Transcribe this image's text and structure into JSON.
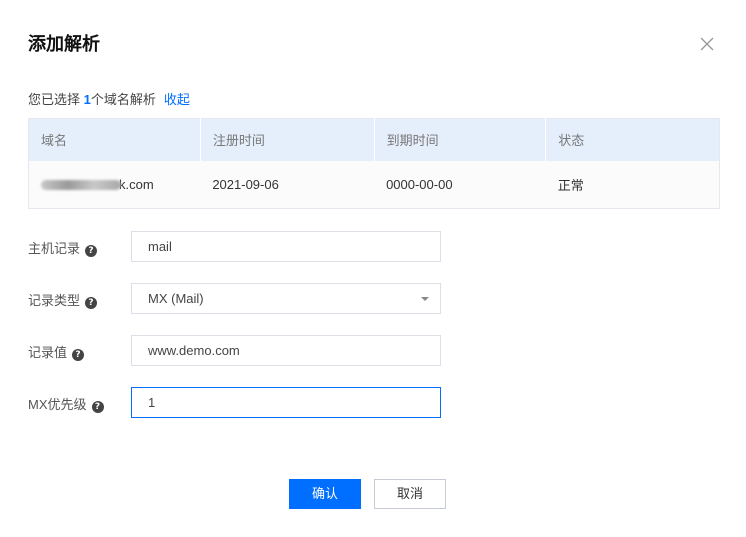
{
  "dialog": {
    "title": "添加解析",
    "close_icon": "close-icon"
  },
  "summary": {
    "prefix": "您已选择 ",
    "count": "1",
    "suffix": "个域名解析",
    "collapse_label": "收起"
  },
  "table": {
    "headers": [
      "域名",
      "注册时间",
      "到期时间",
      "状态"
    ],
    "rows": [
      {
        "domain_visible": "k.com",
        "registered": "2021-09-06",
        "expires": "0000-00-00",
        "status": "正常"
      }
    ]
  },
  "form": {
    "host_record": {
      "label": "主机记录",
      "value": "mail"
    },
    "record_type": {
      "label": "记录类型",
      "value": "MX (Mail)"
    },
    "record_value": {
      "label": "记录值",
      "value": "www.demo.com"
    },
    "mx_priority": {
      "label": "MX优先级",
      "value": "1"
    }
  },
  "buttons": {
    "confirm": "确认",
    "cancel": "取消"
  },
  "colors": {
    "accent": "#006eff",
    "status_ok": "#29a746",
    "table_header_bg": "#e5effc"
  }
}
